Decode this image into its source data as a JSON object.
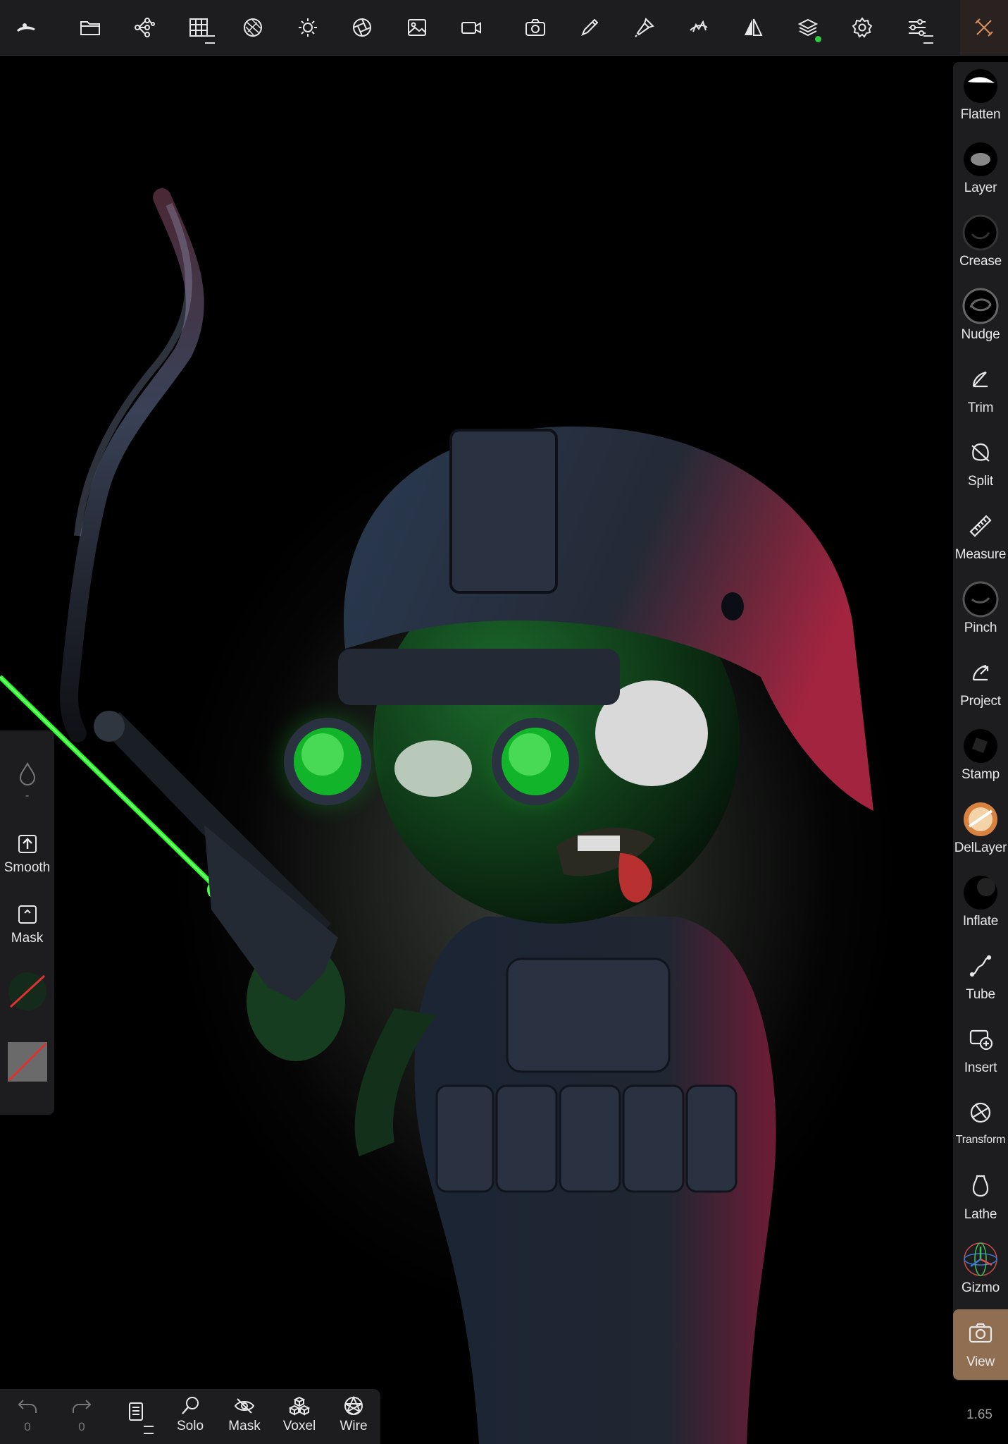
{
  "topbar": {
    "buttons": [
      {
        "icon": "app-logo-icon"
      },
      {
        "icon": "files-folder-icon"
      },
      {
        "icon": "scene-tree-icon"
      },
      {
        "icon": "topology-grid-icon"
      },
      {
        "icon": "material-sphere-icon"
      },
      {
        "icon": "lighting-sun-icon"
      },
      {
        "icon": "postprocess-aperture-icon"
      },
      {
        "icon": "background-image-icon"
      },
      {
        "icon": "video-camera-icon"
      },
      {
        "icon": "screenshot-camera-icon"
      },
      {
        "icon": "brush-pen-icon"
      },
      {
        "icon": "painting-brush-icon"
      },
      {
        "icon": "stroke-hand-icon"
      },
      {
        "icon": "symmetry-icon"
      },
      {
        "icon": "layers-icon"
      },
      {
        "icon": "settings-gear-icon"
      },
      {
        "icon": "sliders-icon"
      },
      {
        "icon": "tools-wrench-icon"
      }
    ],
    "layers_indicator_color": "#2ecc40",
    "tools_accent_color": "#d68a5b"
  },
  "tools": [
    {
      "label": "Flatten",
      "icon": "flatten-brush-icon"
    },
    {
      "label": "Layer",
      "icon": "layer-brush-icon"
    },
    {
      "label": "Crease",
      "icon": "crease-brush-icon"
    },
    {
      "label": "Nudge",
      "icon": "nudge-brush-icon"
    },
    {
      "label": "Trim",
      "icon": "trim-icon"
    },
    {
      "label": "Split",
      "icon": "split-icon"
    },
    {
      "label": "Measure",
      "icon": "ruler-icon"
    },
    {
      "label": "Pinch",
      "icon": "pinch-brush-icon"
    },
    {
      "label": "Project",
      "icon": "project-icon"
    },
    {
      "label": "Stamp",
      "icon": "stamp-brush-icon"
    },
    {
      "label": "DelLayer",
      "icon": "dellayer-brush-icon"
    },
    {
      "label": "Inflate",
      "icon": "inflate-brush-icon"
    },
    {
      "label": "Tube",
      "icon": "tube-curve-icon"
    },
    {
      "label": "Insert",
      "icon": "insert-icon"
    },
    {
      "label": "Transform",
      "icon": "transform-icon"
    },
    {
      "label": "Lathe",
      "icon": "lathe-vase-icon"
    },
    {
      "label": "Gizmo",
      "icon": "gizmo-axes-icon"
    },
    {
      "label": "View",
      "icon": "view-camera-icon",
      "active": true
    }
  ],
  "leftpanel": {
    "radius_value": "-",
    "smooth_label": "Smooth",
    "mask_label": "Mask"
  },
  "bottombar": {
    "undo_count": "0",
    "redo_count": "0",
    "solo_label": "Solo",
    "mask_label": "Mask",
    "voxel_label": "Voxel",
    "wire_label": "Wire"
  },
  "zoom": "1.65",
  "colors": {
    "panel": "#1d1d1f",
    "active_tool": "#8f6e52",
    "laser": "#22ff22"
  }
}
